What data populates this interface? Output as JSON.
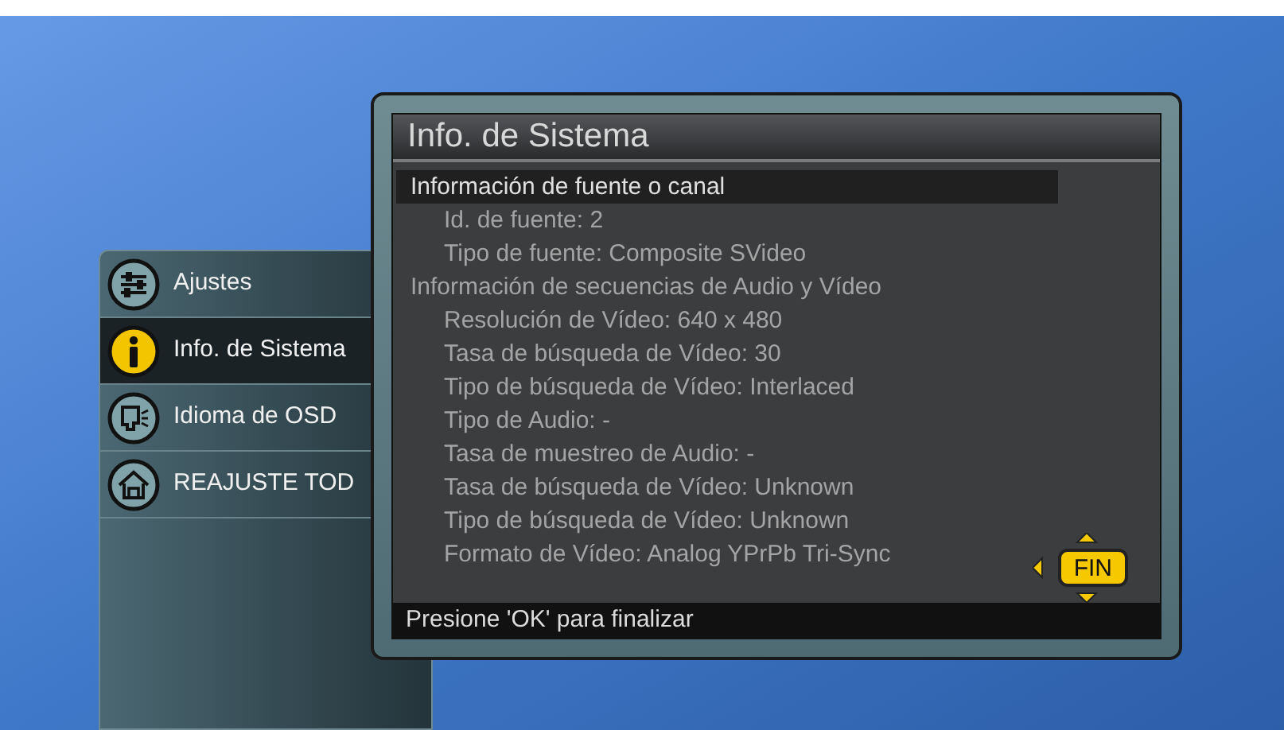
{
  "menu": {
    "items": [
      {
        "label": "Ajustes",
        "kind": "settings",
        "selected": false
      },
      {
        "label": "Info. de Sistema",
        "kind": "info",
        "selected": true
      },
      {
        "label": "Idioma de OSD",
        "kind": "language",
        "selected": false
      },
      {
        "label": "REAJUSTE TOD",
        "kind": "reset",
        "selected": false
      }
    ]
  },
  "dialog": {
    "title": "Info. de Sistema",
    "items": [
      {
        "label": "Información de fuente o canal",
        "selected": true,
        "children": [
          {
            "label": "Id. de fuente: 2",
            "selected": false
          },
          {
            "label": "Tipo de fuente: Composite SVideo",
            "selected": false
          }
        ]
      },
      {
        "label": "Información de secuencias de Audio y Vídeo",
        "selected": false,
        "children": [
          {
            "label": "Resolución de Vídeo: 640 x 480",
            "selected": false
          },
          {
            "label": "Tasa de búsqueda de Vídeo: 30",
            "selected": false
          },
          {
            "label": "Tipo de búsqueda de Vídeo: Interlaced",
            "selected": false
          },
          {
            "label": "Tipo de Audio: -",
            "selected": false
          },
          {
            "label": "Tasa de muestreo de Audio: -",
            "selected": false
          },
          {
            "label": "Tasa de búsqueda de Vídeo: Unknown",
            "selected": false
          },
          {
            "label": "Tipo de búsqueda de Vídeo: Unknown",
            "selected": false
          },
          {
            "label": "Formato de Vídeo: Analog YPrPb Tri-Sync",
            "selected": false
          }
        ]
      }
    ],
    "fin_button": "FIN",
    "footer": "Presione 'OK' para finalizar"
  }
}
